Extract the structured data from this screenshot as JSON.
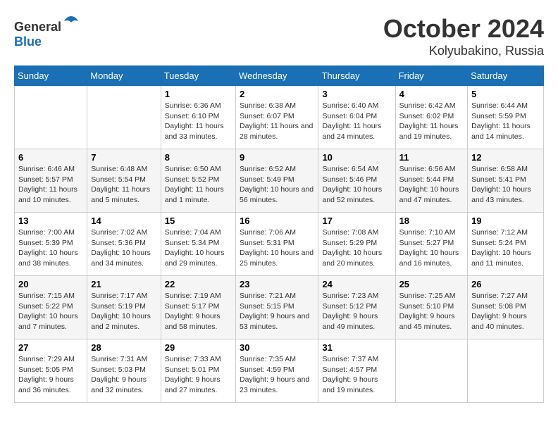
{
  "logo": {
    "text_general": "General",
    "text_blue": "Blue"
  },
  "title": "October 2024",
  "location": "Kolyubakino, Russia",
  "days_of_week": [
    "Sunday",
    "Monday",
    "Tuesday",
    "Wednesday",
    "Thursday",
    "Friday",
    "Saturday"
  ],
  "weeks": [
    [
      {
        "day": "",
        "sunrise": "",
        "sunset": "",
        "daylight": ""
      },
      {
        "day": "",
        "sunrise": "",
        "sunset": "",
        "daylight": ""
      },
      {
        "day": "1",
        "sunrise": "Sunrise: 6:36 AM",
        "sunset": "Sunset: 6:10 PM",
        "daylight": "Daylight: 11 hours and 33 minutes."
      },
      {
        "day": "2",
        "sunrise": "Sunrise: 6:38 AM",
        "sunset": "Sunset: 6:07 PM",
        "daylight": "Daylight: 11 hours and 28 minutes."
      },
      {
        "day": "3",
        "sunrise": "Sunrise: 6:40 AM",
        "sunset": "Sunset: 6:04 PM",
        "daylight": "Daylight: 11 hours and 24 minutes."
      },
      {
        "day": "4",
        "sunrise": "Sunrise: 6:42 AM",
        "sunset": "Sunset: 6:02 PM",
        "daylight": "Daylight: 11 hours and 19 minutes."
      },
      {
        "day": "5",
        "sunrise": "Sunrise: 6:44 AM",
        "sunset": "Sunset: 5:59 PM",
        "daylight": "Daylight: 11 hours and 14 minutes."
      }
    ],
    [
      {
        "day": "6",
        "sunrise": "Sunrise: 6:46 AM",
        "sunset": "Sunset: 5:57 PM",
        "daylight": "Daylight: 11 hours and 10 minutes."
      },
      {
        "day": "7",
        "sunrise": "Sunrise: 6:48 AM",
        "sunset": "Sunset: 5:54 PM",
        "daylight": "Daylight: 11 hours and 5 minutes."
      },
      {
        "day": "8",
        "sunrise": "Sunrise: 6:50 AM",
        "sunset": "Sunset: 5:52 PM",
        "daylight": "Daylight: 11 hours and 1 minute."
      },
      {
        "day": "9",
        "sunrise": "Sunrise: 6:52 AM",
        "sunset": "Sunset: 5:49 PM",
        "daylight": "Daylight: 10 hours and 56 minutes."
      },
      {
        "day": "10",
        "sunrise": "Sunrise: 6:54 AM",
        "sunset": "Sunset: 5:46 PM",
        "daylight": "Daylight: 10 hours and 52 minutes."
      },
      {
        "day": "11",
        "sunrise": "Sunrise: 6:56 AM",
        "sunset": "Sunset: 5:44 PM",
        "daylight": "Daylight: 10 hours and 47 minutes."
      },
      {
        "day": "12",
        "sunrise": "Sunrise: 6:58 AM",
        "sunset": "Sunset: 5:41 PM",
        "daylight": "Daylight: 10 hours and 43 minutes."
      }
    ],
    [
      {
        "day": "13",
        "sunrise": "Sunrise: 7:00 AM",
        "sunset": "Sunset: 5:39 PM",
        "daylight": "Daylight: 10 hours and 38 minutes."
      },
      {
        "day": "14",
        "sunrise": "Sunrise: 7:02 AM",
        "sunset": "Sunset: 5:36 PM",
        "daylight": "Daylight: 10 hours and 34 minutes."
      },
      {
        "day": "15",
        "sunrise": "Sunrise: 7:04 AM",
        "sunset": "Sunset: 5:34 PM",
        "daylight": "Daylight: 10 hours and 29 minutes."
      },
      {
        "day": "16",
        "sunrise": "Sunrise: 7:06 AM",
        "sunset": "Sunset: 5:31 PM",
        "daylight": "Daylight: 10 hours and 25 minutes."
      },
      {
        "day": "17",
        "sunrise": "Sunrise: 7:08 AM",
        "sunset": "Sunset: 5:29 PM",
        "daylight": "Daylight: 10 hours and 20 minutes."
      },
      {
        "day": "18",
        "sunrise": "Sunrise: 7:10 AM",
        "sunset": "Sunset: 5:27 PM",
        "daylight": "Daylight: 10 hours and 16 minutes."
      },
      {
        "day": "19",
        "sunrise": "Sunrise: 7:12 AM",
        "sunset": "Sunset: 5:24 PM",
        "daylight": "Daylight: 10 hours and 11 minutes."
      }
    ],
    [
      {
        "day": "20",
        "sunrise": "Sunrise: 7:15 AM",
        "sunset": "Sunset: 5:22 PM",
        "daylight": "Daylight: 10 hours and 7 minutes."
      },
      {
        "day": "21",
        "sunrise": "Sunrise: 7:17 AM",
        "sunset": "Sunset: 5:19 PM",
        "daylight": "Daylight: 10 hours and 2 minutes."
      },
      {
        "day": "22",
        "sunrise": "Sunrise: 7:19 AM",
        "sunset": "Sunset: 5:17 PM",
        "daylight": "Daylight: 9 hours and 58 minutes."
      },
      {
        "day": "23",
        "sunrise": "Sunrise: 7:21 AM",
        "sunset": "Sunset: 5:15 PM",
        "daylight": "Daylight: 9 hours and 53 minutes."
      },
      {
        "day": "24",
        "sunrise": "Sunrise: 7:23 AM",
        "sunset": "Sunset: 5:12 PM",
        "daylight": "Daylight: 9 hours and 49 minutes."
      },
      {
        "day": "25",
        "sunrise": "Sunrise: 7:25 AM",
        "sunset": "Sunset: 5:10 PM",
        "daylight": "Daylight: 9 hours and 45 minutes."
      },
      {
        "day": "26",
        "sunrise": "Sunrise: 7:27 AM",
        "sunset": "Sunset: 5:08 PM",
        "daylight": "Daylight: 9 hours and 40 minutes."
      }
    ],
    [
      {
        "day": "27",
        "sunrise": "Sunrise: 7:29 AM",
        "sunset": "Sunset: 5:05 PM",
        "daylight": "Daylight: 9 hours and 36 minutes."
      },
      {
        "day": "28",
        "sunrise": "Sunrise: 7:31 AM",
        "sunset": "Sunset: 5:03 PM",
        "daylight": "Daylight: 9 hours and 32 minutes."
      },
      {
        "day": "29",
        "sunrise": "Sunrise: 7:33 AM",
        "sunset": "Sunset: 5:01 PM",
        "daylight": "Daylight: 9 hours and 27 minutes."
      },
      {
        "day": "30",
        "sunrise": "Sunrise: 7:35 AM",
        "sunset": "Sunset: 4:59 PM",
        "daylight": "Daylight: 9 hours and 23 minutes."
      },
      {
        "day": "31",
        "sunrise": "Sunrise: 7:37 AM",
        "sunset": "Sunset: 4:57 PM",
        "daylight": "Daylight: 9 hours and 19 minutes."
      },
      {
        "day": "",
        "sunrise": "",
        "sunset": "",
        "daylight": ""
      },
      {
        "day": "",
        "sunrise": "",
        "sunset": "",
        "daylight": ""
      }
    ]
  ]
}
